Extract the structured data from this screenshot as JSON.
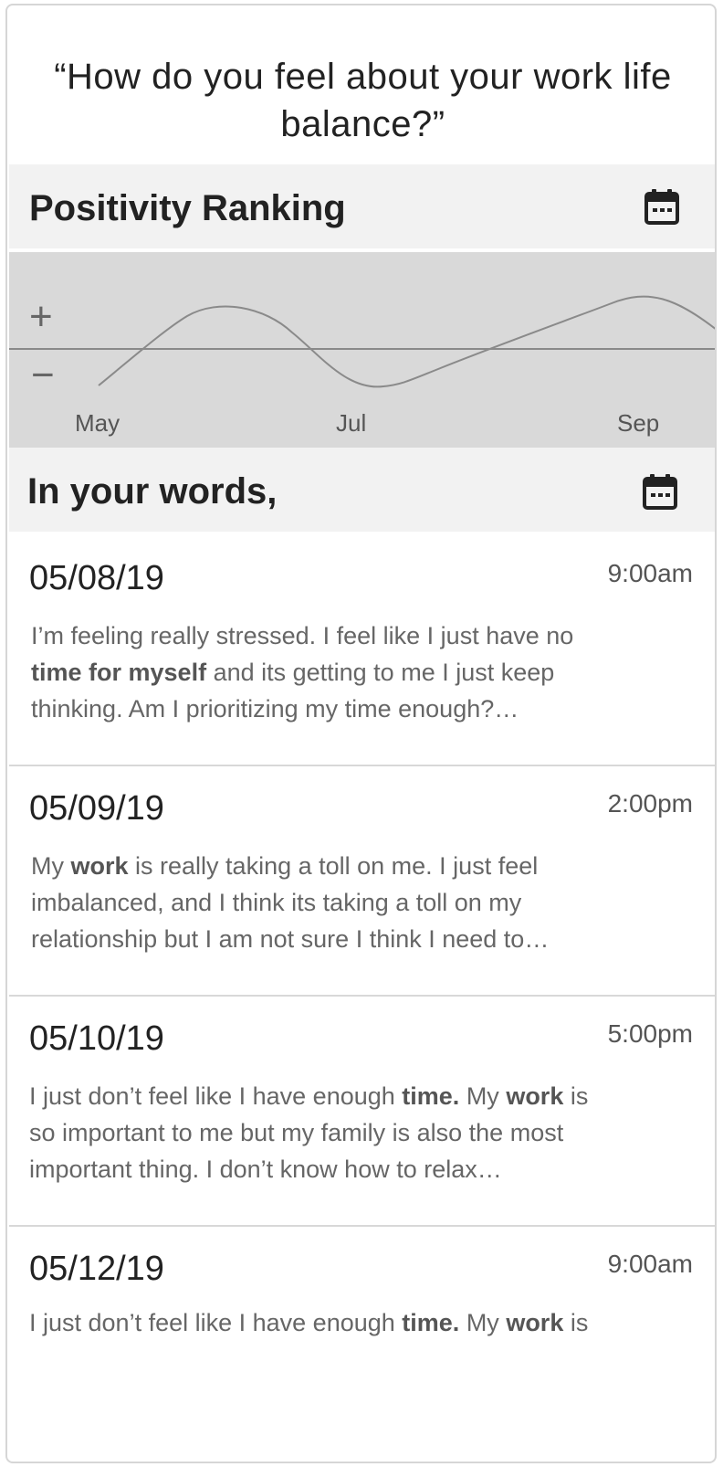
{
  "question": "“How do you feel about your work life balance?”",
  "positivity": {
    "title": "Positivity Ranking",
    "plus_label": "+",
    "minus_label": "−",
    "months": [
      "May",
      "Jul",
      "Sep"
    ]
  },
  "words": {
    "title": "In your words,"
  },
  "entries": [
    {
      "date": "05/08/19",
      "time": "9:00am",
      "text_parts": [
        {
          "t": "I’m feeling really stressed. I feel like I just have no ",
          "b": false
        },
        {
          "t": "time for myself",
          "b": true
        },
        {
          "t": " and its getting to me I just keep thinking. Am I prioritizing my time enough?…",
          "b": false
        }
      ]
    },
    {
      "date": "05/09/19",
      "time": "2:00pm",
      "text_parts": [
        {
          "t": "My ",
          "b": false
        },
        {
          "t": "work",
          "b": true
        },
        {
          "t": " is really taking a toll on me. I just feel imbalanced, and I think its taking a toll on my relationship but I am not sure I think I need to…",
          "b": false
        }
      ]
    },
    {
      "date": "05/10/19",
      "time": "5:00pm",
      "text_parts": [
        {
          "t": "I just don’t feel like I have enough ",
          "b": false
        },
        {
          "t": "time.",
          "b": true
        },
        {
          "t": " My ",
          "b": false
        },
        {
          "t": "work",
          "b": true
        },
        {
          "t": " is so important to me but my family is also the most important thing. I don’t know how to relax…",
          "b": false
        }
      ]
    },
    {
      "date": "05/12/19",
      "time": "9:00am",
      "text_parts": [
        {
          "t": "I just don’t feel like I have enough ",
          "b": false
        },
        {
          "t": "time.",
          "b": true
        },
        {
          "t": " My ",
          "b": false
        },
        {
          "t": "work",
          "b": true
        },
        {
          "t": " is",
          "b": false
        }
      ]
    }
  ]
}
